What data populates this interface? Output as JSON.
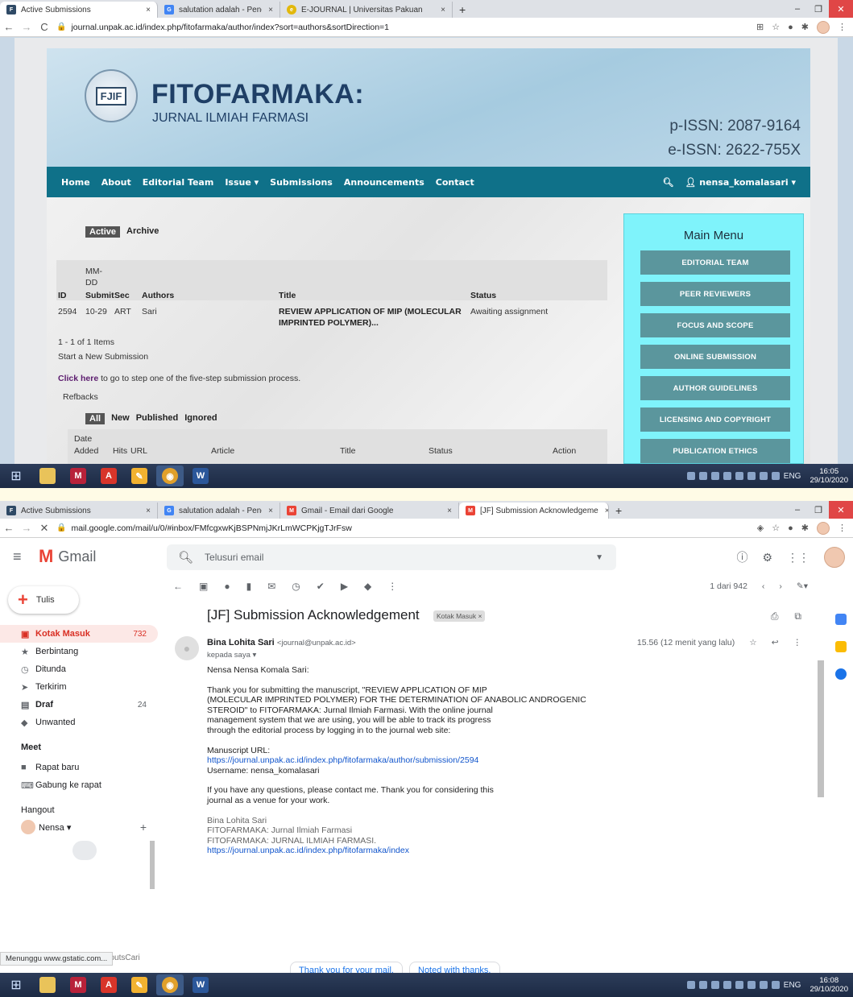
{
  "shot1": {
    "tabs": [
      {
        "label": "Active Submissions",
        "close": "×",
        "fav": "FJIF",
        "fav_color": "#2f4a66"
      },
      {
        "label": "salutation adalah - Penelusuran",
        "close": "×",
        "fav": "G",
        "fav_color": "#4285f4"
      },
      {
        "label": "E-JOURNAL | Universitas Pakuan",
        "close": "×",
        "fav": "e",
        "fav_color": "#e2b80c"
      }
    ],
    "new_tab": "+",
    "url": "journal.unpak.ac.id/index.php/fitofarmaka/author/index?sort=authors&sortDirection=1",
    "journal": {
      "title": "FITOFARMAKA:",
      "subtitle": "JURNAL ILMIAH FARMASI",
      "logo_text": "FJIF",
      "p_issn": "p-ISSN: 2087-9164",
      "e_issn": "e-ISSN: 2622-755X",
      "nav": [
        "Home",
        "About",
        "Editorial Team",
        "Issue ▾",
        "Submissions",
        "Announcements",
        "Contact"
      ],
      "user": "nensa_komalasari ▾",
      "tab_active": "Active",
      "tab_archive": "Archive",
      "headers": {
        "mmdd1": "MM-",
        "mmdd2": "DD",
        "id": "ID",
        "submit": "Submit",
        "sec": "Sec",
        "authors": "Authors",
        "title": "Title",
        "status": "Status"
      },
      "row": {
        "id": "2594",
        "date": "10-29",
        "sec": "ART",
        "author": "Sari",
        "title1": "REVIEW APPLICATION OF MIP (MOLECULAR",
        "title2": "IMPRINTED POLYMER)...",
        "status": "Awaiting assignment"
      },
      "items": "1 - 1 of 1 Items",
      "start_new": "Start a New Submission",
      "click_here": "Click here",
      "click_rest": " to go to step one of the five-step submission process.",
      "refbacks": "Refbacks",
      "ref_tabs": [
        "All",
        "New",
        "Published",
        "Ignored"
      ],
      "ref_headers": {
        "date": "Date",
        "added": "Added",
        "hits": "Hits",
        "url": "URL",
        "article": "Article",
        "title": "Title",
        "status": "Status",
        "action": "Action"
      },
      "main_menu": "Main Menu",
      "menu": [
        "EDITORIAL TEAM",
        "PEER REVIEWERS",
        "FOCUS AND SCOPE",
        "ONLINE SUBMISSION",
        "AUTHOR GUIDELINES",
        "LICENSING AND COPYRIGHT",
        "PUBLICATION ETHICS"
      ]
    },
    "clock": {
      "time": "16:05",
      "date": "29/10/2020"
    }
  },
  "shot2": {
    "tabs": [
      {
        "label": "Active Submissions",
        "close": "×",
        "fav": "FJIF",
        "fav_color": "#2f4a66"
      },
      {
        "label": "salutation adalah - Penelusuran",
        "close": "×",
        "fav": "G",
        "fav_color": "#4285f4"
      },
      {
        "label": "Gmail - Email dari Google",
        "close": "×",
        "fav": "M",
        "fav_color": "#ea4335"
      },
      {
        "label": "[JF] Submission Acknowledgeme",
        "close": "×",
        "fav": "M",
        "fav_color": "#ea4335"
      }
    ],
    "new_tab": "+",
    "url": "mail.google.com/mail/u/0/#inbox/FMfcgxwKjBSPNmjJKrLmWCPKjgTJrFsw",
    "gmail": {
      "brand": "Gmail",
      "search_placeholder": "Telusuri email",
      "compose": "Tulis",
      "nav": [
        {
          "label": "Kotak Masuk",
          "count": "732",
          "icon": "▣"
        },
        {
          "label": "Berbintang",
          "count": "",
          "icon": "★"
        },
        {
          "label": "Ditunda",
          "count": "",
          "icon": "◷"
        },
        {
          "label": "Terkirim",
          "count": "",
          "icon": "➤"
        },
        {
          "label": "Draf",
          "count": "24",
          "icon": "▤"
        },
        {
          "label": "Unwanted",
          "count": "",
          "icon": "◆"
        }
      ],
      "meet": "Meet",
      "meet_items": [
        "Rapat baru",
        "Gabung ke rapat"
      ],
      "hangout": "Hangout",
      "hangout_user": "Nensa ▾",
      "no_contacts": "Tidak ada kontak HangoutsCari",
      "pager": "1 dari 942",
      "subject": "[JF] Submission Acknowledgement",
      "label": "Kotak Masuk ×",
      "sender_name": "Bina Lohita Sari",
      "sender_addr": "<journal@unpak.ac.id>",
      "to": "kepada saya ▾",
      "time": "15.56 (12 menit yang lalu)",
      "greeting": "Nensa Nensa Komala Sari:",
      "para1_lines": [
        "Thank you for submitting the manuscript, \"REVIEW APPLICATION OF MIP",
        "(MOLECULAR IMPRINTED POLYMER) FOR THE DETERMINATION OF ANABOLIC ANDROGENIC",
        "STEROID\" to FITOFARMAKA: Jurnal Ilmiah Farmasi. With the online journal",
        "management system that we are using, you will be able to track its progress",
        "through the editorial process by logging in to the journal web site:"
      ],
      "ms_url_label": "Manuscript URL:",
      "ms_url": "https://journal.unpak.ac.id/index.php/fitofarmaka/author/submission/2594",
      "username": "Username: nensa_komalasari",
      "para2_lines": [
        "If you have any questions, please contact me. Thank you for considering this",
        "journal as a venue for your work."
      ],
      "sig_lines": [
        "Bina Lohita Sari",
        "FITOFARMAKA: Jurnal Ilmiah Farmasi",
        "FITOFARMAKA: JURNAL ILMIAH FARMASI."
      ],
      "sig_url": "https://journal.unpak.ac.id/index.php/fitofarmaka/index",
      "chips": [
        "Thank you for your mail.",
        "Noted with thanks."
      ],
      "status_bar": "Menunggu www.gstatic.com..."
    },
    "clock": {
      "time": "16:08",
      "date": "29/10/2020"
    }
  },
  "tray_lang": "ENG"
}
